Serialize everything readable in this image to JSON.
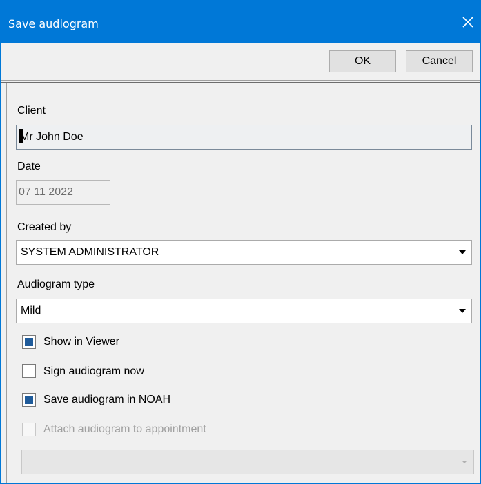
{
  "window": {
    "title": "Save audiogram"
  },
  "toolbar": {
    "ok_label": "OK",
    "cancel_label": "Cancel"
  },
  "client": {
    "label": "Client",
    "value": "Mr John Doe"
  },
  "date": {
    "label": "Date",
    "value": "07 11 2022"
  },
  "created_by": {
    "label": "Created by",
    "selected": "SYSTEM ADMINISTRATOR"
  },
  "audiogram_type": {
    "label": "Audiogram type",
    "selected": "Mild"
  },
  "options": {
    "show_in_viewer": {
      "label": "Show in Viewer",
      "checked": true
    },
    "sign_now": {
      "label": "Sign audiogram now",
      "checked": false
    },
    "save_in_noah": {
      "label": "Save audiogram in NOAH",
      "checked": true
    },
    "attach_appointment": {
      "label": "Attach audiogram to appointment",
      "checked": false,
      "enabled": false
    }
  },
  "appointment": {
    "selected": ""
  },
  "colors": {
    "titlebar": "#0078d7",
    "checkbox_fill": "#1f5b9a",
    "background": "#f0f0f0"
  },
  "icons": {
    "close": "close-icon",
    "dropdown": "chevron-down-icon"
  }
}
